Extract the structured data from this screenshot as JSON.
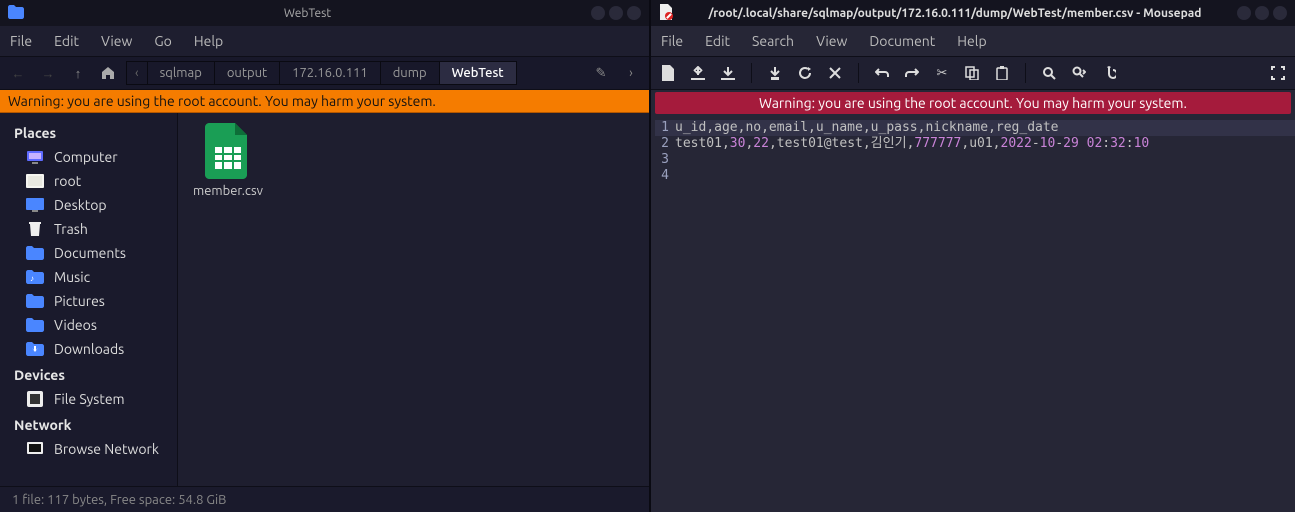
{
  "left": {
    "title": "WebTest",
    "menu": [
      "File",
      "Edit",
      "View",
      "Go",
      "Help"
    ],
    "breadcrumb": [
      "sqlmap",
      "output",
      "172.16.0.111",
      "dump",
      "WebTest"
    ],
    "warning": "Warning: you are using the root account. You may harm your system.",
    "sidebar": {
      "places_label": "Places",
      "devices_label": "Devices",
      "network_label": "Network",
      "places": [
        "Computer",
        "root",
        "Desktop",
        "Trash",
        "Documents",
        "Music",
        "Pictures",
        "Videos",
        "Downloads"
      ],
      "devices": [
        "File System"
      ],
      "network": [
        "Browse Network"
      ]
    },
    "file": {
      "name": "member.csv"
    },
    "status": "1 file: 117 bytes, Free space: 54.8 GiB"
  },
  "right": {
    "title": "/root/.local/share/sqlmap/output/172.16.0.111/dump/WebTest/member.csv - Mousepad",
    "menu": [
      "File",
      "Edit",
      "Search",
      "View",
      "Document",
      "Help"
    ],
    "warning": "Warning: you are using the root account. You may harm your system.",
    "lines": {
      "l1": {
        "no": "1",
        "text": "u_id,age,no,email,u_name,u_pass,nickname,reg_date"
      },
      "l2": {
        "no": "2",
        "seg": {
          "a": "test01,",
          "b": "30",
          "c": ",",
          "d": "22",
          "e": ",test01@test,김인기,",
          "f": "777777",
          "g": ",u01,",
          "h": "2022",
          "i": "-",
          "j": "10",
          "k": "-",
          "l": "29",
          "m": " ",
          "n": "02",
          "o": ":",
          "p": "32",
          "q": ":",
          "r": "10"
        }
      },
      "l3": {
        "no": "3"
      },
      "l4": {
        "no": "4"
      }
    }
  }
}
